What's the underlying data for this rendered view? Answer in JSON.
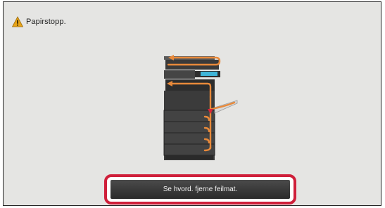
{
  "alert": {
    "icon": "warning-icon",
    "message": "Papirstopp."
  },
  "illustration": {
    "icon": "printer-paper-path-illustration",
    "path_color": "#e8893a",
    "jam_marker_color": "#d8253a"
  },
  "guide": {
    "button_label": "Se hvord. fjerne feilmat.",
    "highlight_color": "#cf1f3a"
  }
}
